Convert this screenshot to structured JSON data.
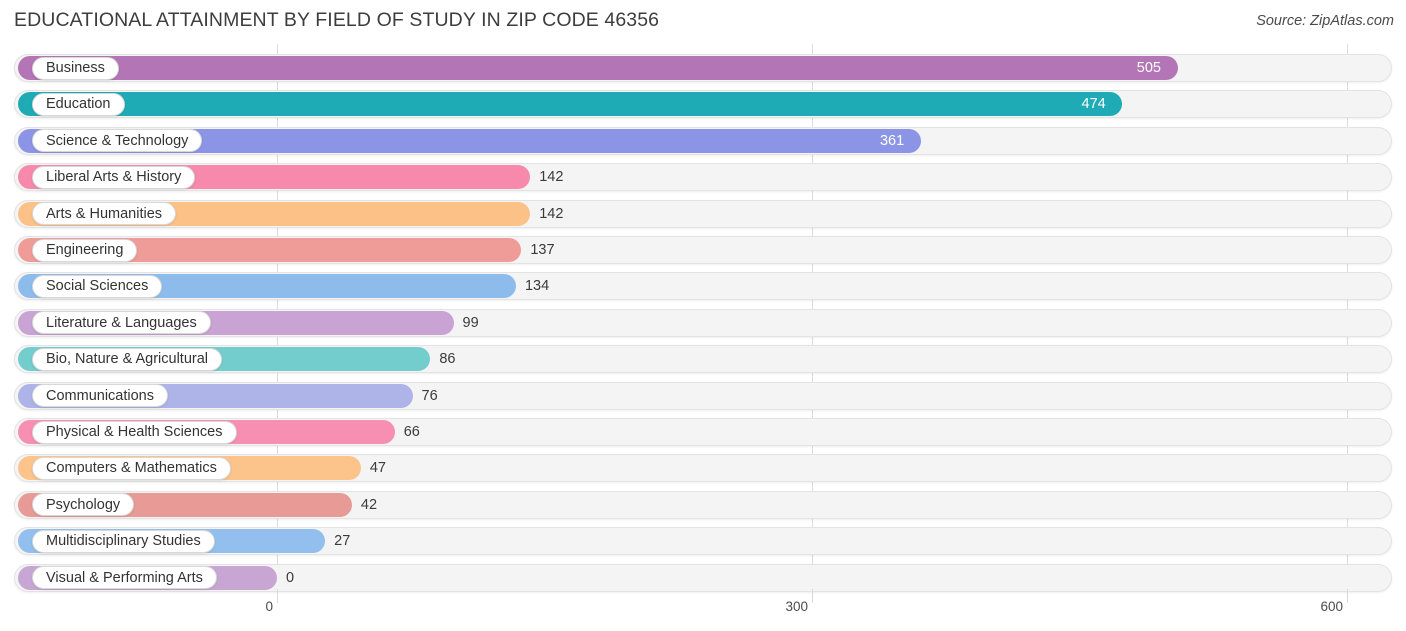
{
  "header": {
    "title": "EDUCATIONAL ATTAINMENT BY FIELD OF STUDY IN ZIP CODE 46356",
    "source": "Source: ZipAtlas.com"
  },
  "chart_data": {
    "type": "bar",
    "orientation": "horizontal",
    "title": "EDUCATIONAL ATTAINMENT BY FIELD OF STUDY IN ZIP CODE 46356",
    "subtitle": "",
    "xlabel": "",
    "ylabel": "",
    "xlim": [
      0,
      600
    ],
    "x_ticks": [
      0,
      300,
      600
    ],
    "x_tick_labels": [
      "0",
      "300",
      "600"
    ],
    "grid": true,
    "legend": null,
    "categories": [
      "Business",
      "Education",
      "Science & Technology",
      "Liberal Arts & History",
      "Arts & Humanities",
      "Engineering",
      "Social Sciences",
      "Literature & Languages",
      "Bio, Nature & Agricultural",
      "Communications",
      "Physical & Health Sciences",
      "Computers & Mathematics",
      "Psychology",
      "Multidisciplinary Studies",
      "Visual & Performing Arts"
    ],
    "values": [
      505,
      474,
      361,
      142,
      142,
      137,
      134,
      99,
      86,
      76,
      66,
      47,
      42,
      27,
      0
    ],
    "value_labels": [
      "505",
      "474",
      "361",
      "142",
      "142",
      "137",
      "134",
      "99",
      "86",
      "76",
      "66",
      "47",
      "42",
      "27",
      "0"
    ],
    "colors": [
      "#b375b5",
      "#1eabb5",
      "#8c95e5",
      "#f689ac",
      "#fcc187",
      "#ef9b97",
      "#8dbcec",
      "#c9a3d3",
      "#74cdcd",
      "#aeb3e8",
      "#f78fb2",
      "#fcc48b",
      "#e79a96",
      "#92bfee",
      "#c8a6d4"
    ]
  },
  "colors": {
    "track_fill": "#f4f4f4",
    "track_border": "#e3e3e3",
    "gridline": "#dcdcdc",
    "text": "#3c3c3c",
    "value_inside": "#ffffff"
  }
}
